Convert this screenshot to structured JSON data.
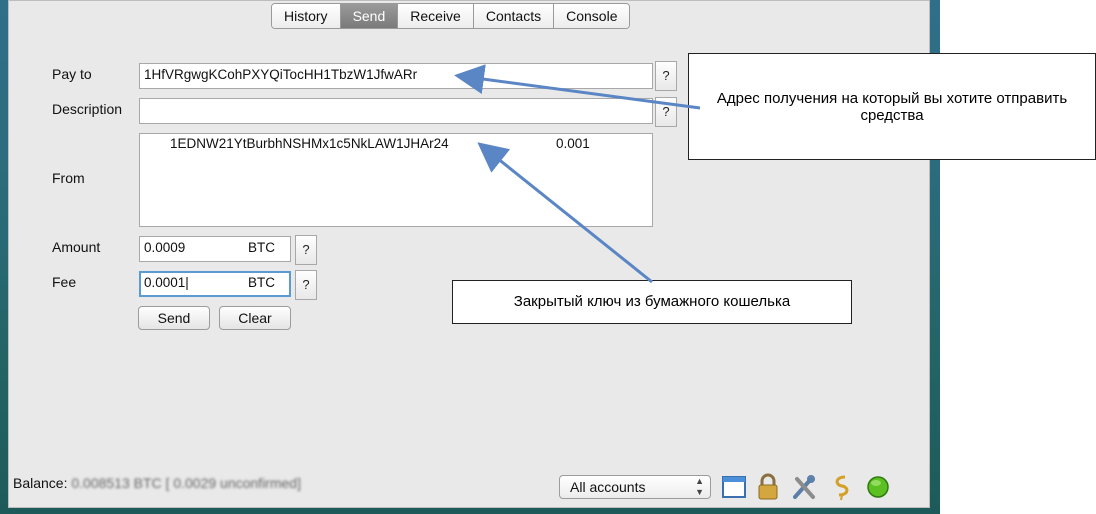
{
  "tabs": [
    {
      "label": "History",
      "active": false
    },
    {
      "label": "Send",
      "active": true
    },
    {
      "label": "Receive",
      "active": false
    },
    {
      "label": "Contacts",
      "active": false
    },
    {
      "label": "Console",
      "active": false
    }
  ],
  "form": {
    "pay_to_label": "Pay to",
    "pay_to_value": "1HfVRgwgKCohPXYQiTocHH1TbzW1JfwARr",
    "description_label": "Description",
    "description_value": "",
    "from_label": "From",
    "from_address": "1EDNW21YtBurbhNSHMx1c5NkLAW1JHAr24",
    "from_amount": "0.001",
    "amount_label": "Amount",
    "amount_value": "0.0009",
    "amount_unit": "BTC",
    "fee_label": "Fee",
    "fee_value": "0.0001|",
    "fee_unit": "BTC",
    "help_label": "?",
    "send_label": "Send",
    "clear_label": "Clear"
  },
  "statusbar": {
    "balance_prefix": "Balance:",
    "balance_value": "0.008513 BTC [ 0.0029 unconfirmed]",
    "accounts_select": "All accounts",
    "icons": [
      "window-icon",
      "lock-icon",
      "tools-icon",
      "sign-icon",
      "status-indicator-icon"
    ],
    "status_color": "#4caf1a"
  },
  "callouts": {
    "pay_to_note": "Адрес получения на который вы хотите отправить средства",
    "private_key_note": "Закрытый ключ из бумажного кошелька"
  },
  "colors": {
    "active_tab": "#8a8a8a",
    "focus_ring": "#5b9bd5",
    "arrow": "#5b86c5"
  }
}
